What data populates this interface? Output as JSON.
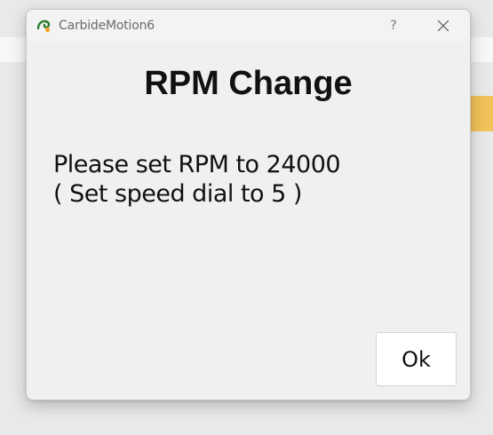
{
  "window": {
    "title": "CarbideMotion6",
    "app_icon": "carbide-dragon-icon",
    "help_label": "?",
    "close_icon": "close-icon"
  },
  "dialog": {
    "heading": "RPM Change",
    "message_line1": "Please set RPM to 24000",
    "message_line2": "( Set speed dial to 5 )",
    "ok_label": "Ok"
  },
  "colors": {
    "dialog_background": "#f0f0f0",
    "background_accent": "#f2c25a",
    "app_icon_green": "#2e7d32",
    "app_icon_orange": "#f5a623"
  }
}
